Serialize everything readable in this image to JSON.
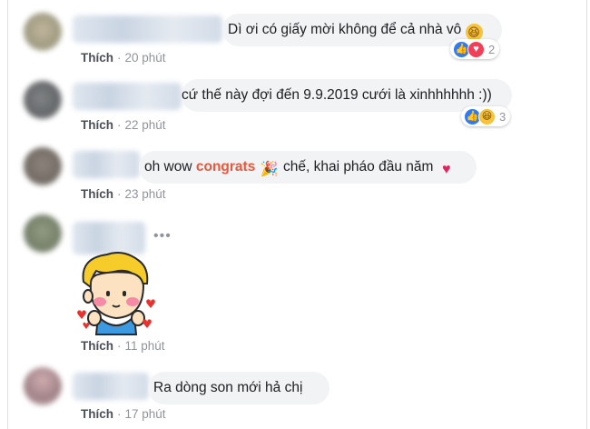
{
  "comments": [
    {
      "text": "Dì ơi có giấy mời không để cả nhà vô",
      "like": "Thích",
      "time": "20 phút",
      "reaction_count": "2",
      "reactions": [
        "like-icon",
        "love-icon"
      ]
    },
    {
      "text": "cứ thế này đợi đến 9.9.2019 cưới là xinhhhhhh :))",
      "like": "Thích",
      "time": "22 phút",
      "reaction_count": "3",
      "reactions": [
        "like-icon",
        "haha-icon"
      ]
    },
    {
      "text_before": "oh wow",
      "text_highlight": "congrats",
      "text_after": "chế, khai pháo đầu năm",
      "like": "Thích",
      "time": "23 phút"
    },
    {
      "sticker": "boy-sticker",
      "like": "Thích",
      "time": "11 phút",
      "more": "•••"
    },
    {
      "text": "Ra dòng son mới hả chị",
      "like": "Thích",
      "time": "17 phút"
    }
  ],
  "colors": {
    "bubble": "#f2f3f5",
    "meta": "#90949c",
    "highlight": "#e8583d",
    "like_blue": "#2e7bf6"
  }
}
